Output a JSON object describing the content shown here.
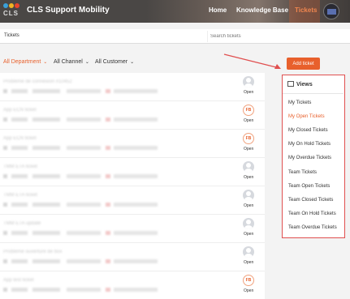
{
  "header": {
    "logo_text": "CLS",
    "title": "CLS Support Mobility",
    "nav": [
      "Home",
      "Knowledge Base",
      "Tickets"
    ],
    "active_nav": "Tickets"
  },
  "subbar": {
    "breadcrumb": "Tickets",
    "search_placeholder": "Search tickets"
  },
  "filters": [
    {
      "label": "All Department",
      "selected": true
    },
    {
      "label": "All Channel",
      "selected": false
    },
    {
      "label": "All Customer",
      "selected": false
    }
  ],
  "add_ticket_label": "Add ticket",
  "tickets": [
    {
      "title": "Problème de connexion #10452",
      "agent": "grey",
      "agent_initials": "",
      "status": "Open"
    },
    {
      "title": "App ECN ticket",
      "agent": "fb",
      "agent_initials": "FB",
      "status": "Open"
    },
    {
      "title": "App ECN ticket",
      "agent": "fb",
      "agent_initials": "FB",
      "status": "Open"
    },
    {
      "title": "TMM ETA ticket",
      "agent": "grey",
      "agent_initials": "",
      "status": "Open"
    },
    {
      "title": "TMM ETA ticket",
      "agent": "grey",
      "agent_initials": "",
      "status": "Open"
    },
    {
      "title": "TMM ETA update",
      "agent": "grey",
      "agent_initials": "",
      "status": "Open"
    },
    {
      "title": "Problème ouverture de box",
      "agent": "grey",
      "agent_initials": "",
      "status": "Open"
    },
    {
      "title": "App test ticket",
      "agent": "fb",
      "agent_initials": "FB",
      "status": "Open"
    }
  ],
  "views": {
    "title": "Views",
    "items": [
      {
        "label": "My Tickets",
        "active": false
      },
      {
        "label": "My Open Tickets",
        "active": true
      },
      {
        "label": "My Closed Tickets",
        "active": false
      },
      {
        "label": "My On Hold Tickets",
        "active": false
      },
      {
        "label": "My Overdue Tickets",
        "active": false
      },
      {
        "label": "Team Tickets",
        "active": false
      },
      {
        "label": "Team Open Tickets",
        "active": false
      },
      {
        "label": "Team Closed Tickets",
        "active": false
      },
      {
        "label": "Team On Hold Tickets",
        "active": false
      },
      {
        "label": "Team Overdue Tickets",
        "active": false
      }
    ]
  },
  "colors": {
    "accent": "#e8602c",
    "header_bg": "#4a4745",
    "annotation_red": "#e05050"
  }
}
